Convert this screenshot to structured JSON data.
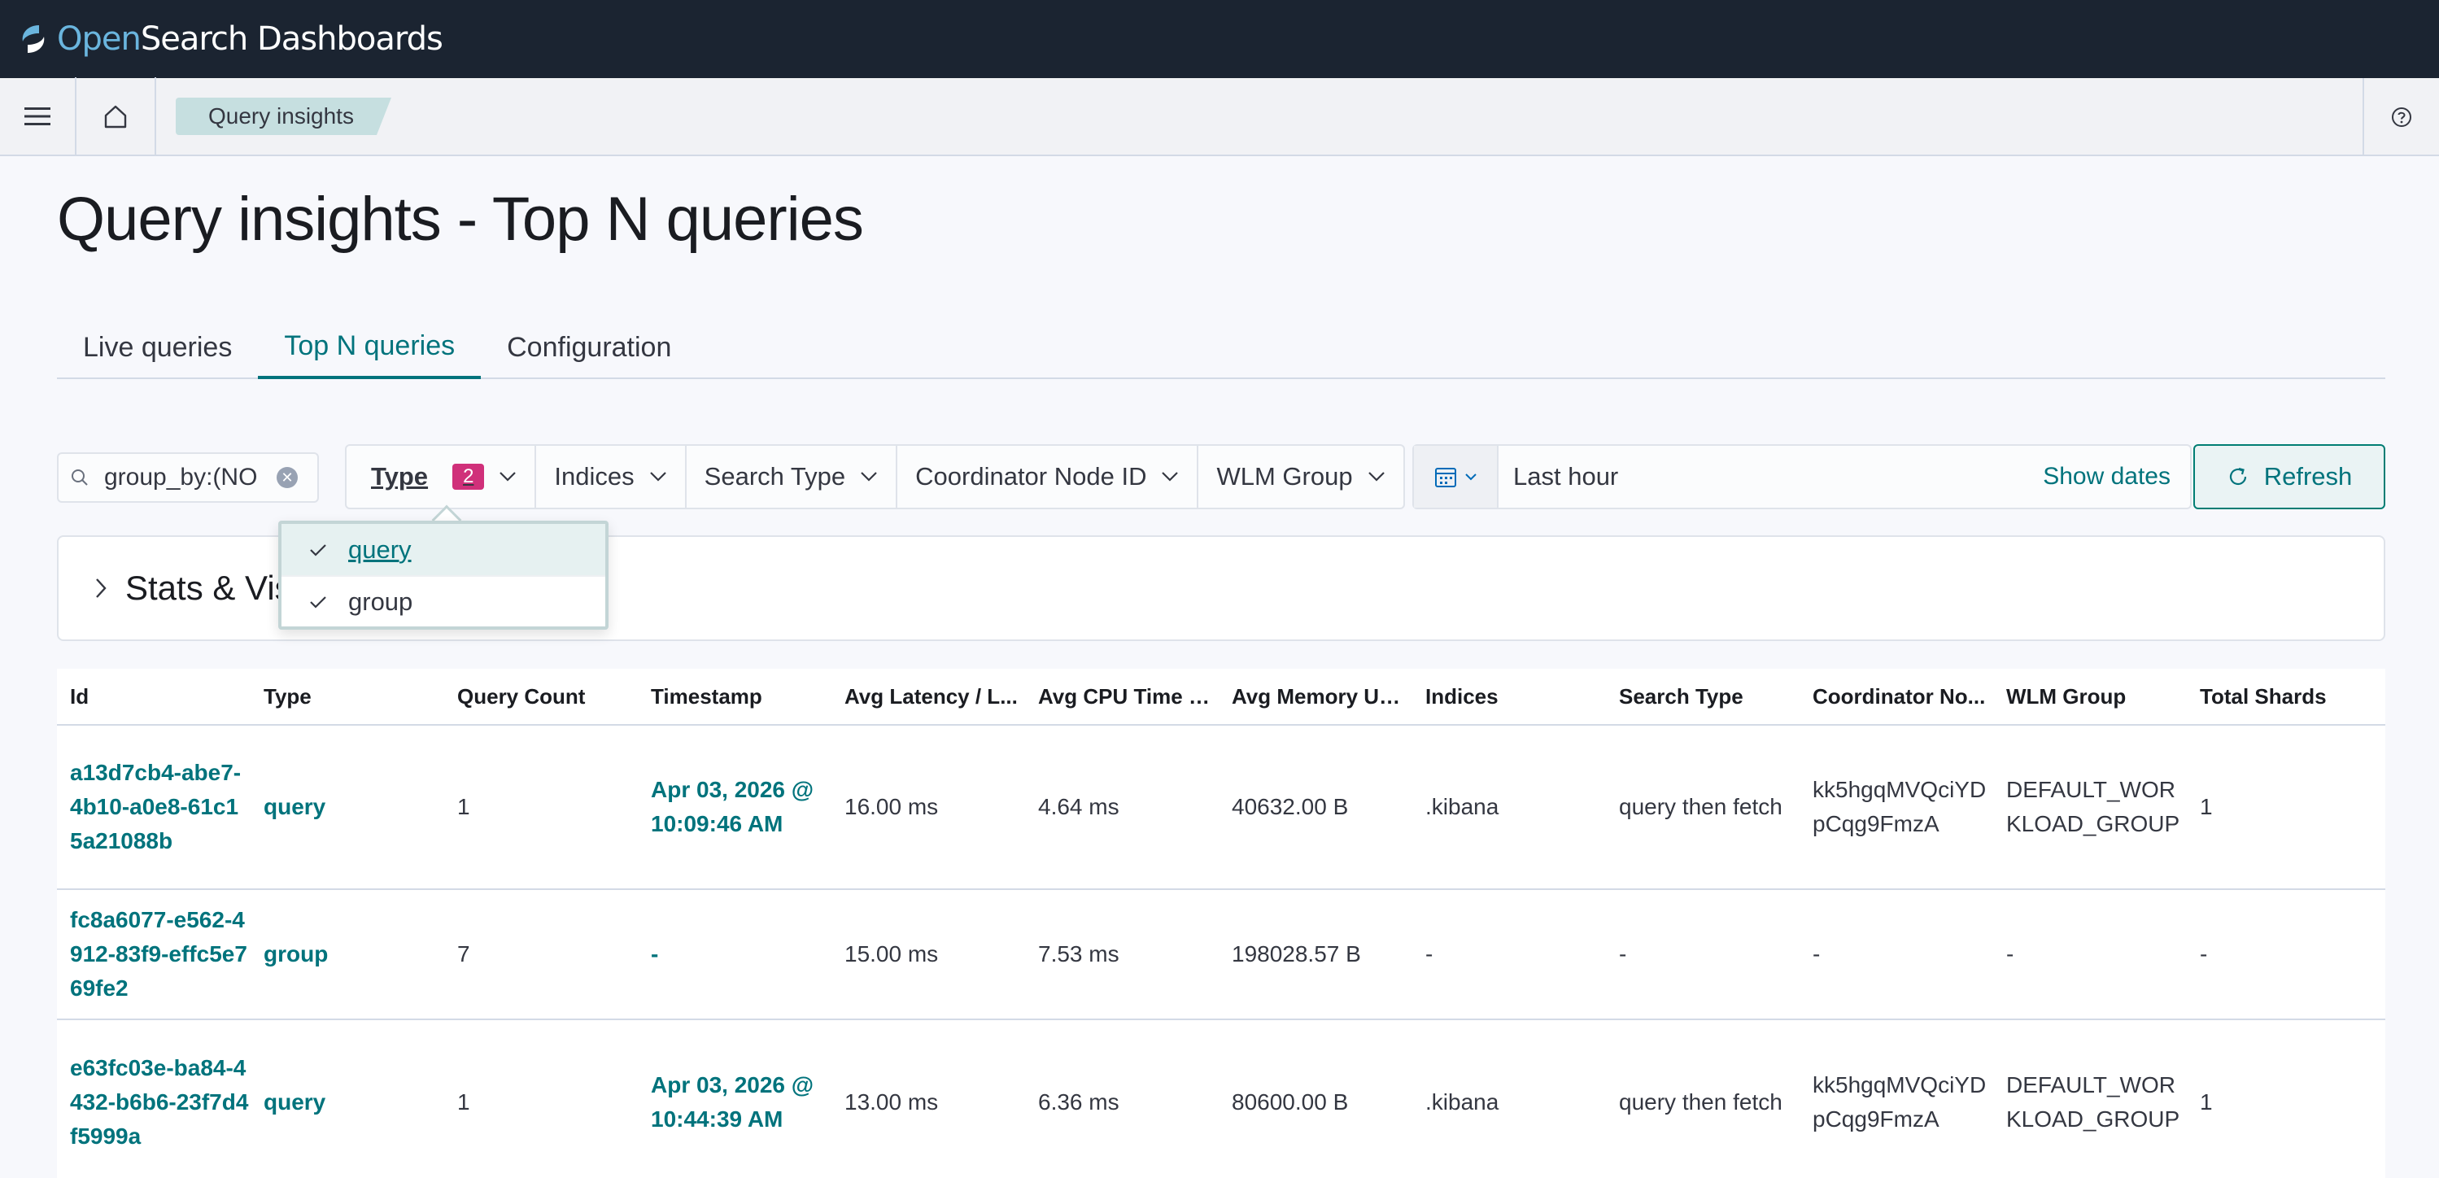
{
  "app": {
    "logo_open": "Open",
    "logo_rest": "Search Dashboards"
  },
  "breadcrumb": {
    "current": "Query insights"
  },
  "page": {
    "title": "Query insights - Top N queries"
  },
  "tabs": [
    {
      "label": "Live queries",
      "active": false
    },
    {
      "label": "Top N queries",
      "active": true
    },
    {
      "label": "Configuration",
      "active": false
    }
  ],
  "search": {
    "value": "group_by:(NO"
  },
  "filters": {
    "type_label": "Type",
    "type_count": "2",
    "indices_label": "Indices",
    "search_type_label": "Search Type",
    "coordinator_label": "Coordinator Node ID",
    "wlm_label": "WLM Group"
  },
  "type_dropdown": {
    "options": [
      {
        "label": "query",
        "checked": true
      },
      {
        "label": "group",
        "checked": true
      }
    ]
  },
  "datepicker": {
    "value": "Last hour",
    "show_dates": "Show dates"
  },
  "refresh": {
    "label": "Refresh"
  },
  "stats": {
    "title": "Stats & Visualizations"
  },
  "table": {
    "columns": [
      "Id",
      "Type",
      "Query Count",
      "Timestamp",
      "Avg Latency / L...",
      "Avg CPU Time / ...",
      "Avg Memory Us...",
      "Indices",
      "Search Type",
      "Coordinator No...",
      "WLM Group",
      "Total Shards"
    ],
    "rows": [
      {
        "id": "a13d7cb4-abe7-4b10-a0e8-61c15a21088b",
        "type": "query",
        "count": "1",
        "timestamp": "Apr 03, 2026 @ 10:09:46 AM",
        "latency": "16.00 ms",
        "cpu": "4.64 ms",
        "memory": "40632.00 B",
        "indices": ".kibana",
        "search_type": "query then fetch",
        "coordinator": "kk5hgqMVQciYDpCqg9FmzA",
        "wlm": "DEFAULT_WORKLOAD_GROUP",
        "shards": "1"
      },
      {
        "id": "fc8a6077-e562-4912-83f9-effc5e769fe2",
        "type": "group",
        "count": "7",
        "timestamp": "-",
        "latency": "15.00 ms",
        "cpu": "7.53 ms",
        "memory": "198028.57 B",
        "indices": "-",
        "search_type": "-",
        "coordinator": "-",
        "wlm": "-",
        "shards": "-"
      },
      {
        "id": "e63fc03e-ba84-4432-b6b6-23f7d4f5999a",
        "type": "query",
        "count": "1",
        "timestamp": "Apr 03, 2026 @ 10:44:39 AM",
        "latency": "13.00 ms",
        "cpu": "6.36 ms",
        "memory": "80600.00 B",
        "indices": ".kibana",
        "search_type": "query then fetch",
        "coordinator": "kk5hgqMVQciYDpCqg9FmzA",
        "wlm": "DEFAULT_WORKLOAD_GROUP",
        "shards": "1"
      }
    ]
  }
}
